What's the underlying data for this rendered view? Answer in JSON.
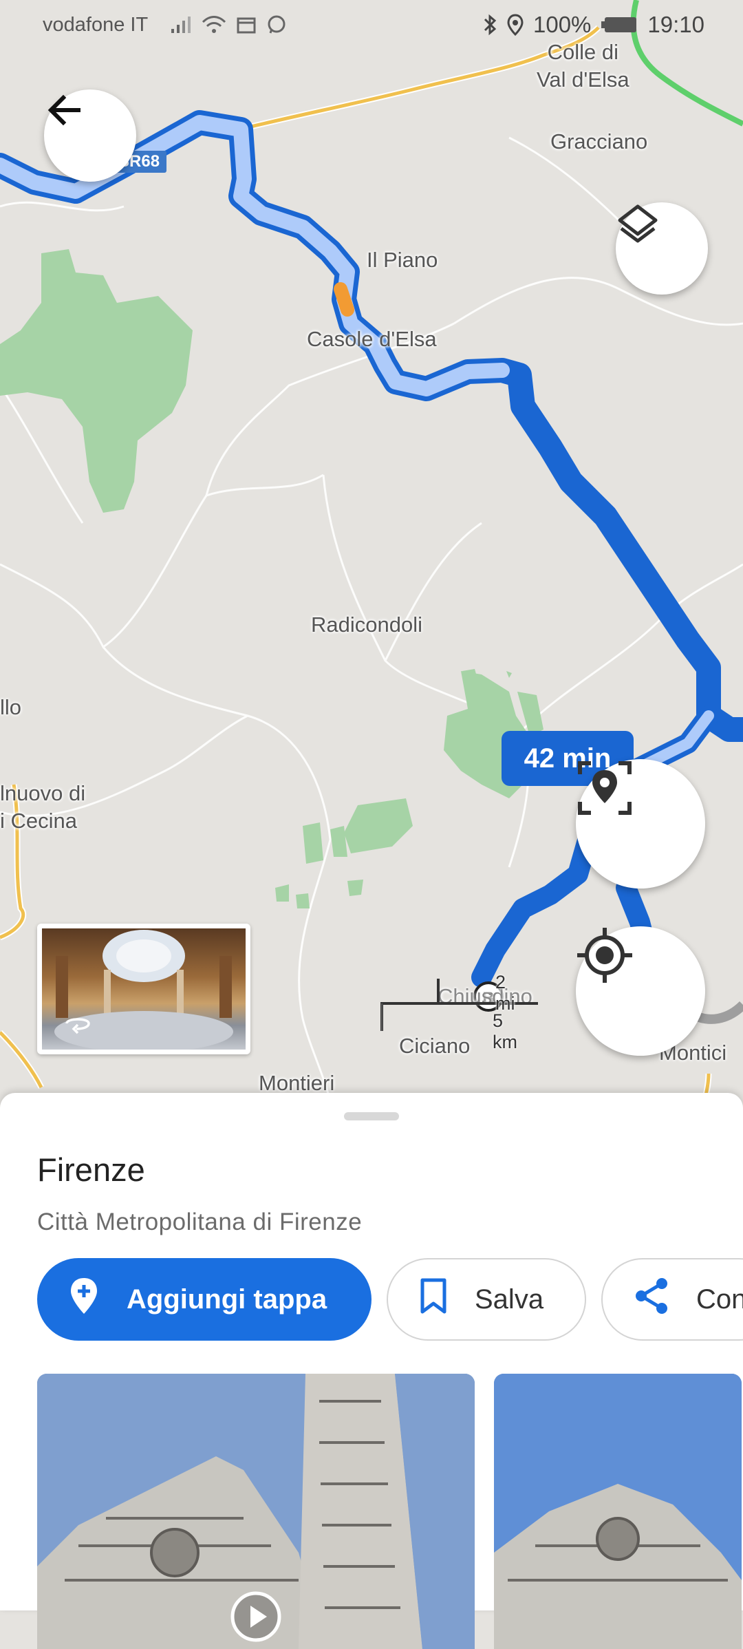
{
  "status_bar": {
    "carrier": "vodafone IT",
    "battery": "100%",
    "time": "19:10",
    "icons": [
      "signal-icon",
      "wifi-icon",
      "calendar-icon",
      "whatsapp-icon",
      "bluetooth-icon",
      "location-icon",
      "battery-icon"
    ]
  },
  "map": {
    "route_badge": "SR68",
    "eta": "42 min",
    "places": {
      "colle": "Colle di\nVal d'Elsa",
      "gracciano": "Gracciano",
      "il_piano": "Il Piano",
      "casole": "Casole d'Elsa",
      "radicondoli": "Radicondoli",
      "llo": "llo",
      "nuovo": "lnuovo di\ni Cecina",
      "chiusdino": "Chiusdino",
      "ciciano": "Ciciano",
      "montieri": "Montieri",
      "monticiano": "Montici"
    },
    "scale": {
      "mi": "2 mi",
      "km": "5 km"
    },
    "route_color": "#1a6fe0",
    "route_outline_color": "#aecbfa"
  },
  "sheet": {
    "title": "Firenze",
    "subtitle": "Città Metropolitana di Firenze",
    "add_stop": "Aggiungi tappa",
    "save": "Salva",
    "share": "Con"
  }
}
